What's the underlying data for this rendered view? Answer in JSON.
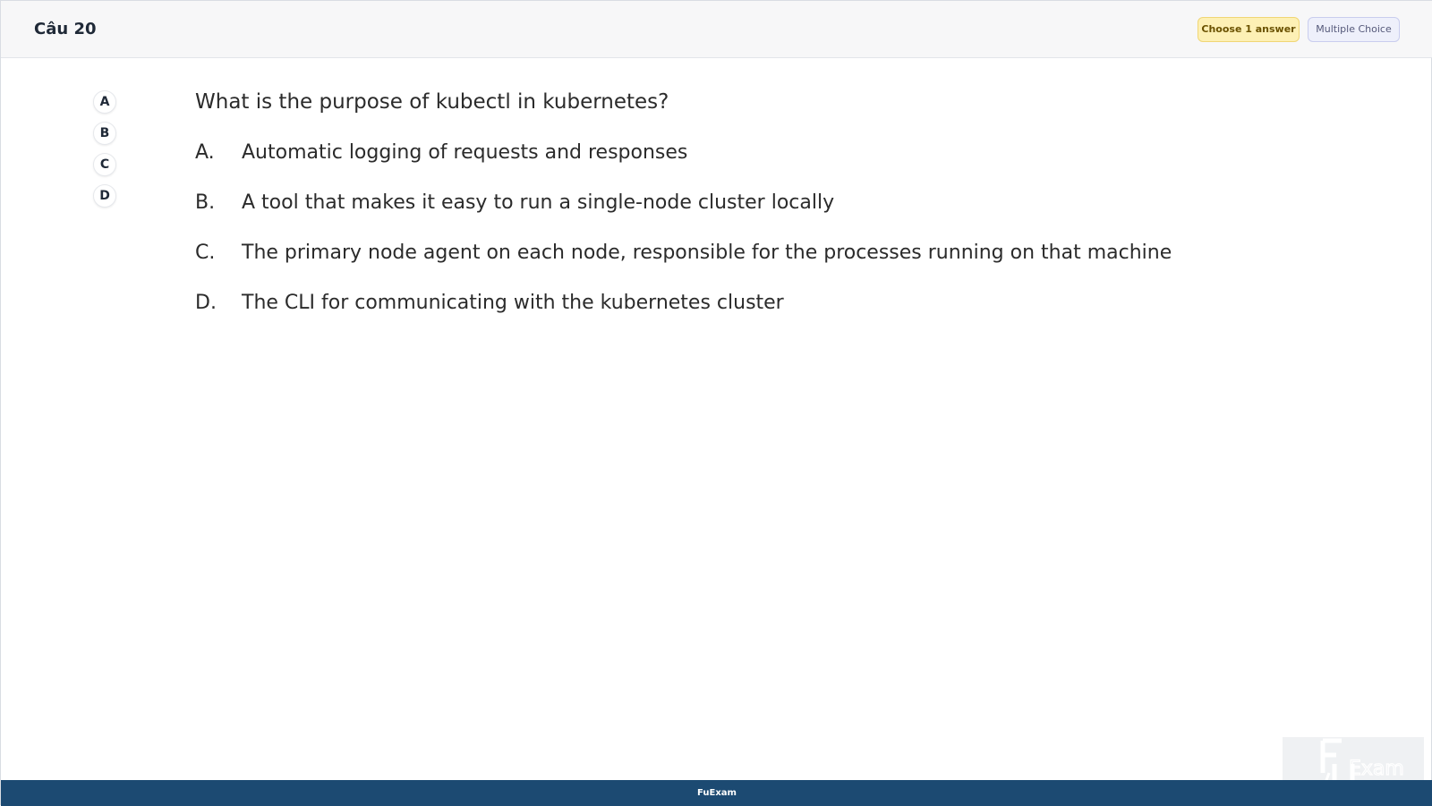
{
  "header": {
    "title": "Câu 20",
    "badge_choose": "Choose 1 answer",
    "badge_type": "Multiple Choice"
  },
  "side_options": [
    "A",
    "B",
    "C",
    "D"
  ],
  "question": {
    "text": "What is the purpose of kubectl in kubernetes?",
    "answers": [
      {
        "letter": "A.",
        "text": "Automatic logging of requests and responses"
      },
      {
        "letter": "B.",
        "text": "A tool that makes it easy to run a single-node cluster locally"
      },
      {
        "letter": "C.",
        "text": "The primary node agent on each node, responsible for the processes running on that machine"
      },
      {
        "letter": "D.",
        "text": "The CLI for communicating with the kubernetes cluster"
      }
    ]
  },
  "footer": {
    "text": "FuExam"
  },
  "logo": {
    "text": "FU Exam"
  }
}
